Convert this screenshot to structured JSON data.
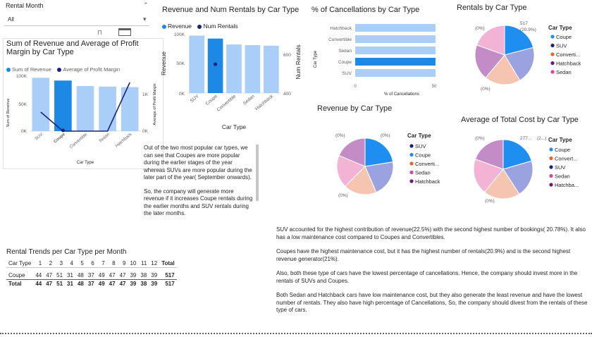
{
  "slicer": {
    "label": "Rental Month",
    "value": "All",
    "chevron": "▾",
    "up": "⌃"
  },
  "colors": {
    "revenue": "#a9cef7",
    "coupe_highlight": "#1e88e5",
    "line": "#1a237e",
    "suv": "#1f8ef1",
    "coupe": "#9aa3df",
    "convertible": "#f5c5b2",
    "sedan": "#f3b3d5",
    "hatchback": "#c48cc6",
    "text": "#252423",
    "muted": "#605e5c"
  },
  "chart1": {
    "title": "Sum of Revenue and Average of Profit Margin by Car Type",
    "legend": [
      "Sum of Revenue",
      "Average of Profit Margin"
    ],
    "y_ticks": [
      "100K",
      "50K",
      "0K"
    ],
    "y2_ticks": [
      "1K",
      "0K"
    ],
    "ylabel": "Sum of Revenue",
    "y2label": "Average of Profit Margin",
    "xlabel": "Car Type"
  },
  "chart2": {
    "title": "Revenue and Num Rentals by Car Type",
    "legend": [
      "Revenue",
      "Num Rentals"
    ],
    "y_ticks": [
      "100K",
      "50K",
      "0K"
    ],
    "y2_ticks": [
      "600",
      "400"
    ],
    "ylabel": "Revenue",
    "y2label": "Num Rentals",
    "xlabel": "Car Type"
  },
  "chart3": {
    "title": "% of Cancellations by Car Type",
    "ylabel": "Car Type",
    "xlabel": "% of Cancellations",
    "x_ticks": [
      "0",
      "50"
    ]
  },
  "chart4": {
    "title": "Rentals by Car Type",
    "legend_title": "Car Type",
    "labels": [
      "517",
      "(20.9%)",
      "(0%)",
      "(0%)"
    ],
    "legend": [
      "Coupe",
      "SUV",
      "Converti...",
      "Hatchback",
      "Sedan"
    ]
  },
  "chart5": {
    "title": "Revenue by Car Type",
    "legend_title": "Car Type",
    "labels": [
      "(0%)",
      "(0%)",
      "(0%)"
    ],
    "legend": [
      "SUV",
      "Coupe",
      "Converti...",
      "Sedan",
      "Hatchback"
    ]
  },
  "chart6": {
    "title": "Average of Total Cost by Car Type",
    "legend_title": "Car Type",
    "labels": [
      "277...",
      "(2...)",
      "(0%)",
      "(0%)"
    ],
    "legend": [
      "Coupe",
      "Convert...",
      "SUV",
      "Sedan",
      "Hatchba..."
    ]
  },
  "chart_data": [
    {
      "type": "bar",
      "title": "Sum of Revenue and Average of Profit Margin by Car Type",
      "categories": [
        "SUV",
        "Coupe",
        "Convertible",
        "Sedan",
        "Hatchback"
      ],
      "series": [
        {
          "name": "Sum of Revenue",
          "values": [
            97000,
            92000,
            82000,
            81000,
            80000
          ]
        },
        {
          "name": "Average of Profit Margin",
          "values": [
            450,
            0,
            0,
            0,
            1150
          ]
        }
      ],
      "xlabel": "Car Type",
      "ylabel": "Sum of Revenue",
      "ylim": [
        0,
        100000
      ]
    },
    {
      "type": "bar",
      "title": "Revenue and Num Rentals by Car Type",
      "categories": [
        "SUV",
        "Coupe",
        "Convertible",
        "Sedan",
        "Hatchback"
      ],
      "series": [
        {
          "name": "Revenue",
          "values": [
            97000,
            92000,
            82000,
            81000,
            80000
          ]
        },
        {
          "name": "Num Rentals",
          "values": [
            null,
            517,
            null,
            null,
            null
          ]
        }
      ],
      "xlabel": "Car Type",
      "ylabel": "Revenue",
      "ylim": [
        0,
        100000
      ]
    },
    {
      "type": "bar",
      "title": "% of Cancellations by Car Type",
      "categories": [
        "Hatchback",
        "Convertible",
        "Sedan",
        "Coupe",
        "SUV"
      ],
      "values": [
        56,
        56,
        56,
        56,
        56
      ],
      "xlabel": "% of Cancellations",
      "ylabel": "Car Type",
      "xlim": [
        0,
        58
      ]
    },
    {
      "type": "pie",
      "title": "Rentals by Car Type",
      "categories": [
        "Coupe",
        "SUV",
        "Convertible",
        "Hatchback",
        "Sedan"
      ],
      "values": [
        20.9,
        20.5,
        19.7,
        19.4,
        19.5
      ]
    },
    {
      "type": "pie",
      "title": "Revenue by Car Type",
      "categories": [
        "SUV",
        "Coupe",
        "Convertible",
        "Sedan",
        "Hatchback"
      ],
      "values": [
        22.5,
        21.0,
        19.0,
        18.8,
        18.7
      ]
    },
    {
      "type": "pie",
      "title": "Average of Total Cost by Car Type",
      "categories": [
        "Coupe",
        "Convertible",
        "SUV",
        "Sedan",
        "Hatchback"
      ],
      "values": [
        20.5,
        20.3,
        20.1,
        19.6,
        19.5
      ]
    }
  ],
  "notes": {
    "left_p1": "Out of the two most popular car types, we can see that Coupes are more popular during the earlier stages of the year whereas SUVs are more popular during the later part of the year( September onwards).",
    "left_p2": "So, the company will generate more revenue if it increases Coupe rentals during the earlier months and SUV rentals during the later months.",
    "right_p1": "SUV accounted for the highest contribution of revenue(22.5%) with the second highest number of bookings( 20.78%). It also has a low maintenance cost compared to Coupes and Convertibles.",
    "right_p2": "Coupes have the highest maintenance cost, but it has the highest number of rentals(20.9%) and is the second highest revenue generator(21%).",
    "right_p3": "Also, both these type of cars have the lowest percentage of cancellations. Hence, the company should invest more in the rentals of SUVs and Coupes.",
    "right_p4": "Both Sedan and Hatchback cars have low maintenance cost, but they also generate the least revenue and have the lowest number of rentals. They also have high percentage of Cancellations, So, the company should divest from the rentals of these type of cars."
  },
  "matrix": {
    "title": "Rental Trends per Car Type per Month",
    "header": [
      "Car Type",
      "1",
      "2",
      "3",
      "4",
      "5",
      "6",
      "7",
      "8",
      "9",
      "10",
      "11",
      "12",
      "Total"
    ],
    "rows": [
      [
        "Coupe",
        "44",
        "47",
        "51",
        "31",
        "48",
        "37",
        "49",
        "47",
        "47",
        "39",
        "38",
        "39",
        "517"
      ],
      [
        "Total",
        "44",
        "47",
        "51",
        "31",
        "48",
        "37",
        "49",
        "47",
        "47",
        "39",
        "38",
        "39",
        "517"
      ]
    ]
  }
}
